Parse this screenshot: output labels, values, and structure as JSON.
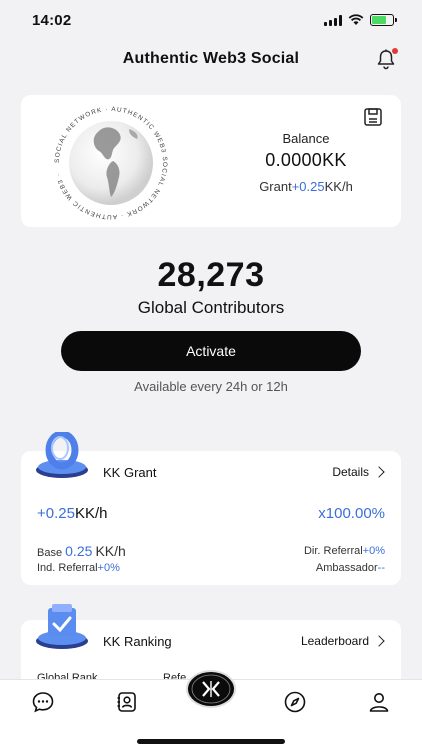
{
  "status_bar": {
    "time": "14:02"
  },
  "header": {
    "title": "Authentic Web3 Social"
  },
  "balance_card": {
    "logo_ring_text": "SOCIAL NETWORK · AUTHENTIC WEB3 SOCIAL NETWORK · AUTHENTIC WEB3 ·",
    "label": "Balance",
    "value": "0.0000KK",
    "grant_prefix": "Grant",
    "grant_rate": "+0.25",
    "grant_unit": "KK/h"
  },
  "contributors": {
    "count": "28,273",
    "label": "Global Contributors"
  },
  "activate": {
    "button_label": "Activate",
    "note": "Available every 24h or 12h"
  },
  "grant_card": {
    "title": "KK Grant",
    "link_label": "Details",
    "rate_value": "+0.25",
    "rate_unit": "KK/h",
    "multiplier": "x100.00%",
    "base_label": "Base",
    "base_value": "0.25",
    "base_unit": "KK/h",
    "dir_referral_label": "Dir. Referral",
    "dir_referral_value": "+0%",
    "ind_referral_label": "Ind. Referral",
    "ind_referral_value": "+0%",
    "ambassador_label": "Ambassador",
    "ambassador_value": "--"
  },
  "ranking_card": {
    "title": "KK Ranking",
    "link_label": "Leaderboard",
    "sub_left": "Global Rank",
    "sub_mid": "Refe"
  },
  "tabbar": {
    "center_logo_text": "KK",
    "tabs": [
      "chat",
      "contacts",
      "kk",
      "explore",
      "profile"
    ]
  },
  "colors": {
    "accent_blue": "#3b6fd8",
    "primary_dark": "#0a0a0a",
    "notif_red": "#e53935"
  }
}
